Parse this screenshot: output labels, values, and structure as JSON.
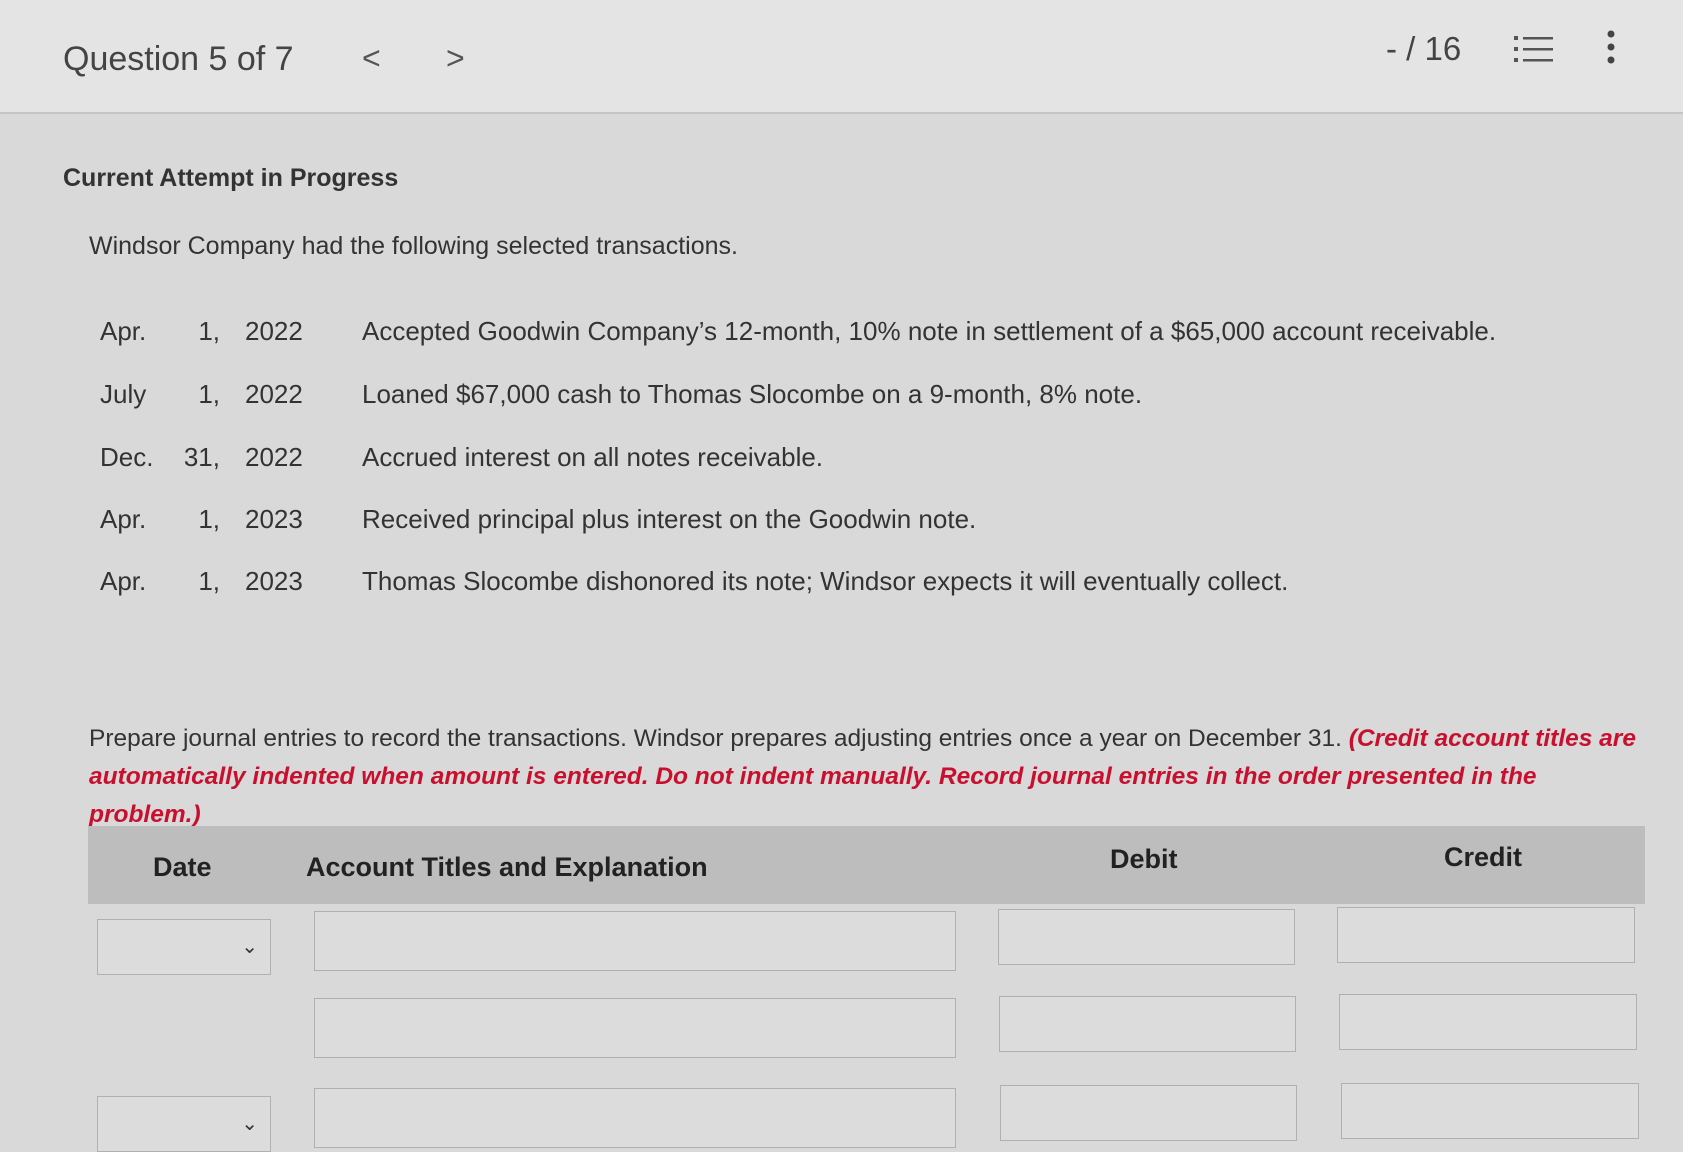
{
  "header": {
    "question_label": "Question 5 of 7",
    "prev_glyph": "<",
    "next_glyph": ">",
    "score": "- / 16",
    "icons": [
      "list-icon",
      "more-vertical-icon"
    ]
  },
  "main": {
    "attempt_label": "Current Attempt in Progress",
    "intro": "Windsor Company had the following selected transactions.",
    "transactions": [
      {
        "month": "Apr.",
        "day": "1,",
        "year": "2022",
        "description": "Accepted Goodwin Company’s 12-month, 10% note in settlement of a $65,000 account receivable."
      },
      {
        "month": "July",
        "day": "1,",
        "year": "2022",
        "description": "Loaned $67,000 cash to Thomas Slocombe on a 9-month, 8% note."
      },
      {
        "month": "Dec.",
        "day": "31,",
        "year": "2022",
        "description": "Accrued interest on all notes receivable."
      },
      {
        "month": "Apr.",
        "day": "1,",
        "year": "2023",
        "description": "Received principal plus interest on the Goodwin note."
      },
      {
        "month": "Apr.",
        "day": "1,",
        "year": "2023",
        "description": "Thomas Slocombe dishonored its note; Windsor expects it will eventually collect."
      }
    ],
    "instructions": "Prepare journal entries to record the transactions. Windsor prepares adjusting entries once a year on December 31.",
    "instructions_note": "(Credit account titles are automatically indented when amount is entered. Do not indent manually. Record journal entries in the order presented in the problem.)"
  },
  "journal_table": {
    "headers": {
      "date": "Date",
      "account": "Account Titles and Explanation",
      "debit": "Debit",
      "credit": "Credit"
    },
    "chevron_glyph": "⌄",
    "rows": [
      {
        "date": "",
        "account": "",
        "debit": "",
        "credit": ""
      },
      {
        "account": "",
        "debit": "",
        "credit": ""
      },
      {
        "date": "",
        "account": "",
        "debit": "",
        "credit": ""
      }
    ]
  },
  "colors": {
    "accent_red": "#c8102e",
    "header_bg": "#bdbdbd"
  }
}
